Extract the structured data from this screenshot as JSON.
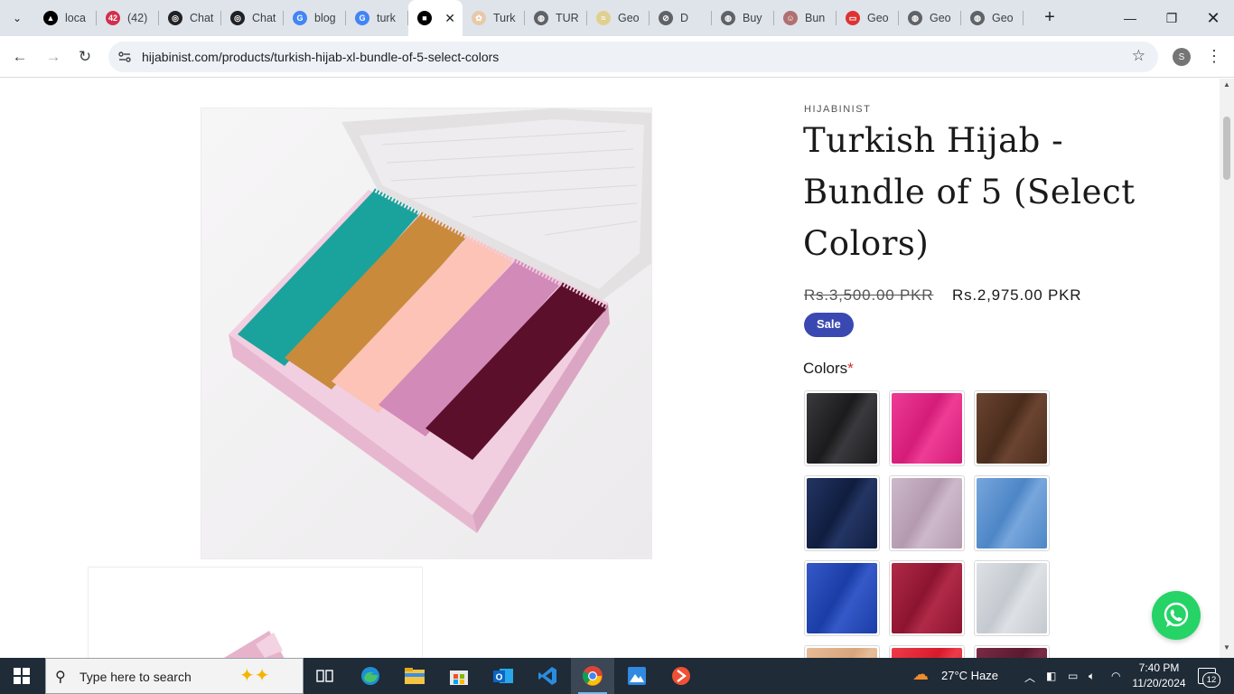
{
  "browser": {
    "tabs": [
      {
        "label": "loca",
        "fav_color": "#000000",
        "fav_glyph": "▲"
      },
      {
        "label": "(42)",
        "fav_color": "#d32f4c",
        "fav_glyph": "42"
      },
      {
        "label": "Chat",
        "fav_color": "#202124",
        "fav_glyph": "◎"
      },
      {
        "label": "Chat",
        "fav_color": "#202124",
        "fav_glyph": "◎"
      },
      {
        "label": "blog",
        "fav_color": "#4285f4",
        "fav_glyph": "G"
      },
      {
        "label": "turk",
        "fav_color": "#4285f4",
        "fav_glyph": "G"
      },
      {
        "label": "",
        "fav_color": "#000000",
        "fav_glyph": "■",
        "active": true
      },
      {
        "label": "Turk",
        "fav_color": "#e8c9a8",
        "fav_glyph": "✿"
      },
      {
        "label": "TUR",
        "fav_color": "#5f6368",
        "fav_glyph": "◍"
      },
      {
        "label": "Geo",
        "fav_color": "#e0d090",
        "fav_glyph": "≈"
      },
      {
        "label": "D",
        "fav_color": "#5f6368",
        "fav_glyph": "⊘"
      },
      {
        "label": "Buy",
        "fav_color": "#5f6368",
        "fav_glyph": "◍"
      },
      {
        "label": "Bun",
        "fav_color": "#b07070",
        "fav_glyph": "☺"
      },
      {
        "label": "Geo",
        "fav_color": "#d33",
        "fav_glyph": "▭"
      },
      {
        "label": "Geo",
        "fav_color": "#5f6368",
        "fav_glyph": "◍"
      },
      {
        "label": "Geo",
        "fav_color": "#5f6368",
        "fav_glyph": "◍"
      }
    ],
    "new_tab": "+",
    "url": "hijabinist.com/products/turkish-hijab-xl-bundle-of-5-select-colors",
    "profile_initial": "S"
  },
  "product": {
    "vendor": "HIJABINIST",
    "title": "Turkish Hijab - Bundle of 5 (Select Colors)",
    "price_old": "Rs.3,500.00 PKR",
    "price_new": "Rs.2,975.00 PKR",
    "sale_badge": "Sale",
    "colors_label": "Colors",
    "required_mark": "*",
    "swatches": [
      {
        "name": "black",
        "color": "#1b1b1d",
        "hi": "#3a3a3e"
      },
      {
        "name": "hot-pink",
        "color": "#d41c78",
        "hi": "#ee3c95"
      },
      {
        "name": "brown",
        "color": "#4a2c1c",
        "hi": "#6b4431"
      },
      {
        "name": "navy",
        "color": "#101d3f",
        "hi": "#233563"
      },
      {
        "name": "mauve",
        "color": "#b49ab0",
        "hi": "#cdb8ca"
      },
      {
        "name": "sky-blue",
        "color": "#4d86c6",
        "hi": "#77a6dc"
      },
      {
        "name": "royal-blue",
        "color": "#1a3da6",
        "hi": "#3559c8"
      },
      {
        "name": "maroon",
        "color": "#8c1430",
        "hi": "#b02a47"
      },
      {
        "name": "light-grey",
        "color": "#c4c9cf",
        "hi": "#dde1e5"
      },
      {
        "name": "beige",
        "color": "#d8a57c",
        "hi": "#e6bc98"
      },
      {
        "name": "red",
        "color": "#d81a2c",
        "hi": "#ec3b4a"
      },
      {
        "name": "plum",
        "color": "#5a1a30",
        "hi": "#7a2a46"
      }
    ],
    "bundle_colors": [
      "#1aa39c",
      "#c98a3c",
      "#fcc3b6",
      "#d28ab8",
      "#5c0f2b"
    ]
  },
  "taskbar": {
    "search_placeholder": "Type here to search",
    "weather": "27°C  Haze",
    "time": "7:40 PM",
    "date": "11/20/2024",
    "notifications": "12"
  }
}
